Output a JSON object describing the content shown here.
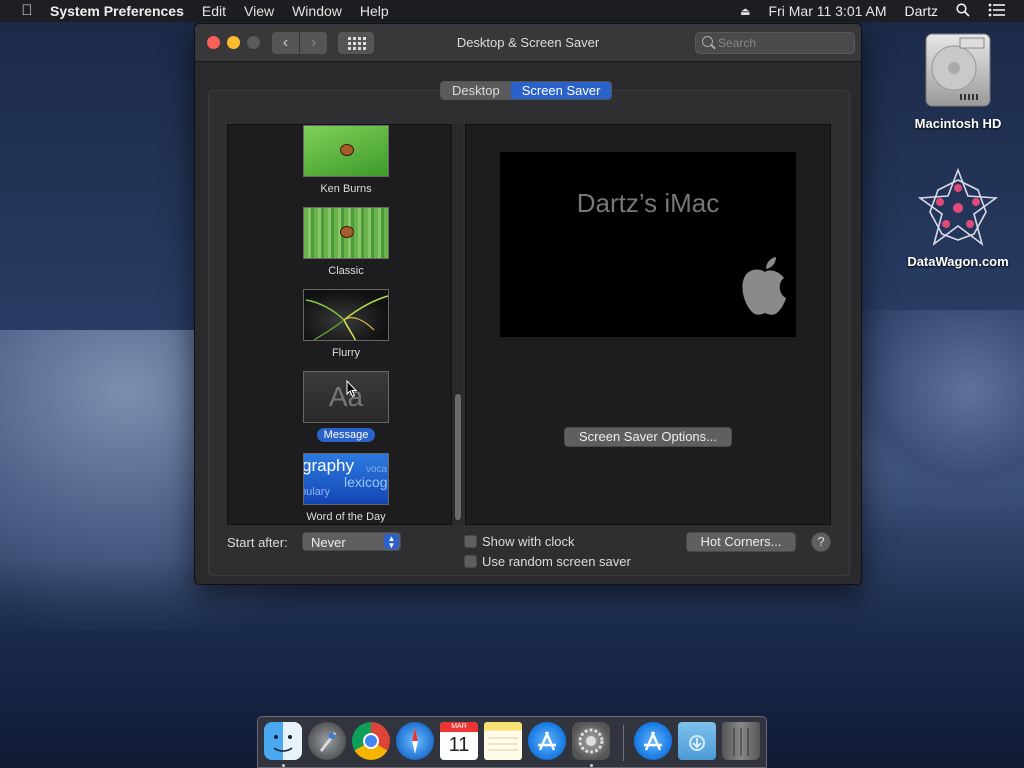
{
  "menubar": {
    "app_name": "System Preferences",
    "menus": [
      "Edit",
      "View",
      "Window",
      "Help"
    ],
    "datetime": "Fri Mar 11  3:01 AM",
    "user": "Dartz"
  },
  "window": {
    "title": "Desktop & Screen Saver",
    "search_placeholder": "Search",
    "tabs": [
      {
        "label": "Desktop",
        "active": false
      },
      {
        "label": "Screen Saver",
        "active": true
      }
    ]
  },
  "savers": [
    {
      "label": "Ken Burns",
      "selected": false
    },
    {
      "label": "Classic",
      "selected": false
    },
    {
      "label": "Flurry",
      "selected": false
    },
    {
      "label": "Message",
      "selected": true,
      "thumb_text": "Aa"
    },
    {
      "label": "Word of the Day",
      "selected": false,
      "thumb_words": [
        "graphy",
        "lexicog",
        "bulary",
        "voca"
      ]
    }
  ],
  "preview": {
    "message": "Dartz’s iMac"
  },
  "controls": {
    "options_button": "Screen Saver Options...",
    "start_after_label": "Start after:",
    "start_after_value": "Never",
    "show_clock_label": "Show with clock",
    "show_clock_checked": false,
    "random_label": "Use random screen saver",
    "random_checked": false,
    "hot_corners_button": "Hot Corners...",
    "help_label": "?"
  },
  "desktop_icons": [
    {
      "label": "Macintosh HD",
      "icon": "hard-drive-icon"
    },
    {
      "label": "DataWagon.com",
      "icon": "geometric-star-icon"
    }
  ],
  "dock": {
    "apps": [
      "finder-icon",
      "launchpad-icon",
      "chrome-icon",
      "safari-icon",
      "calendar-icon",
      "notes-icon",
      "app-store-icon",
      "system-preferences-icon",
      "app-store-download-icon",
      "downloads-folder-icon",
      "trash-icon"
    ],
    "calendar": {
      "month": "MAR",
      "day": "11"
    }
  },
  "colors": {
    "accent": "#2a62c9",
    "close": "#fc5f57",
    "minimize": "#fdbc2e"
  }
}
